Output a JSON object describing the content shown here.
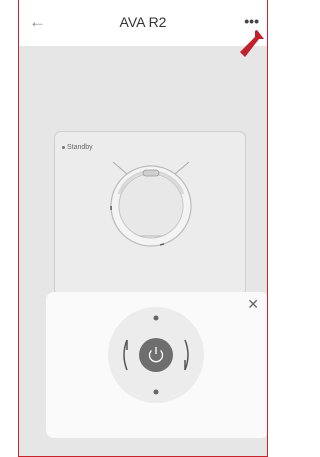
{
  "header": {
    "title": "AVA R2",
    "back_icon": "←",
    "more_icon": "•••"
  },
  "card": {
    "status": "Standby"
  },
  "panel": {
    "close_icon": "✕"
  },
  "colors": {
    "accent": "#c8242c",
    "power_button": "#6e6e6e"
  }
}
